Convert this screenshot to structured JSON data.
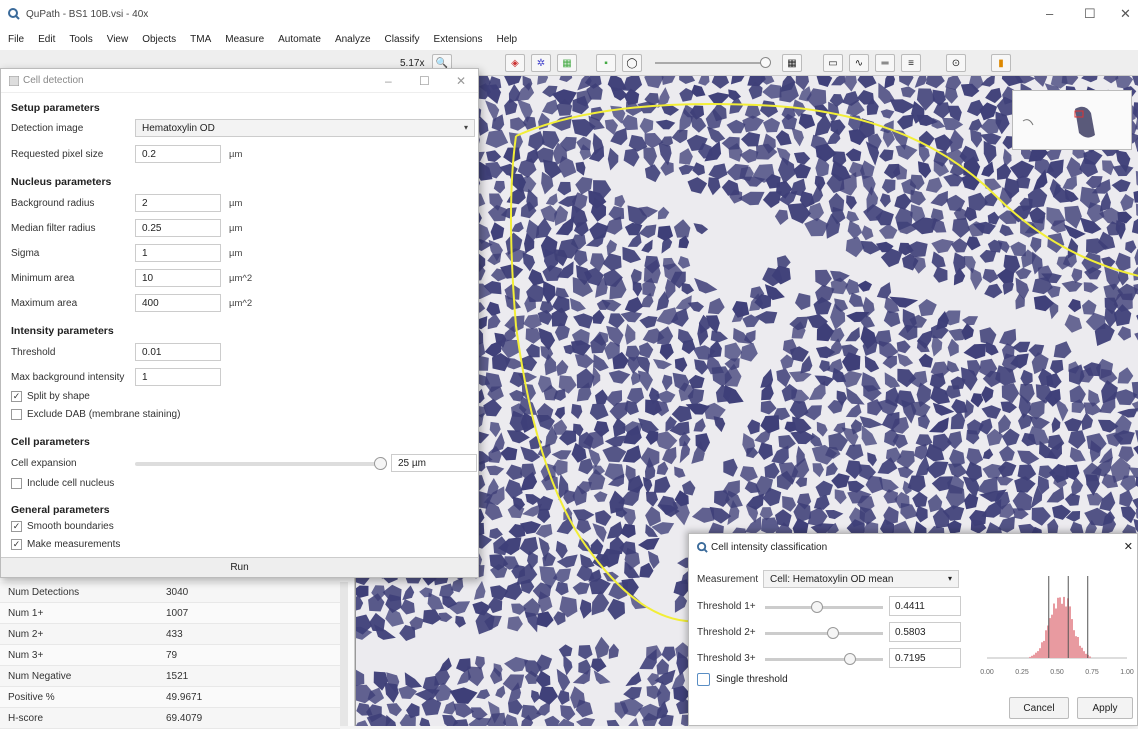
{
  "window": {
    "title": "QuPath - BS1 10B.vsi - 40x",
    "minimize": "–",
    "maximize": "☐",
    "close": "✕"
  },
  "menu": [
    "File",
    "Edit",
    "Tools",
    "View",
    "Objects",
    "TMA",
    "Measure",
    "Automate",
    "Analyze",
    "Classify",
    "Extensions",
    "Help"
  ],
  "toolbar": {
    "zoom": "5.17x"
  },
  "cell_detection": {
    "title": "Cell detection",
    "sections": {
      "setup": "Setup parameters",
      "nucleus": "Nucleus parameters",
      "intensity": "Intensity parameters",
      "cell": "Cell parameters",
      "general": "General parameters"
    },
    "detection_image": {
      "label": "Detection image",
      "value": "Hematoxylin OD"
    },
    "pixel_size": {
      "label": "Requested pixel size",
      "value": "0.2",
      "unit": "µm"
    },
    "background_radius": {
      "label": "Background radius",
      "value": "2",
      "unit": "µm"
    },
    "median_filter": {
      "label": "Median filter radius",
      "value": "0.25",
      "unit": "µm"
    },
    "sigma": {
      "label": "Sigma",
      "value": "1",
      "unit": "µm"
    },
    "min_area": {
      "label": "Minimum area",
      "value": "10",
      "unit": "µm^2"
    },
    "max_area": {
      "label": "Maximum area",
      "value": "400",
      "unit": "µm^2"
    },
    "threshold": {
      "label": "Threshold",
      "value": "0.01"
    },
    "max_bg_intensity": {
      "label": "Max background intensity",
      "value": "1"
    },
    "split_by_shape": {
      "label": "Split by shape",
      "checked": true
    },
    "exclude_dab": {
      "label": "Exclude DAB (membrane staining)",
      "checked": false
    },
    "cell_expansion": {
      "label": "Cell expansion",
      "value": "25 µm",
      "slider_fraction": 1.0
    },
    "include_nucleus": {
      "label": "Include cell nucleus",
      "checked": false
    },
    "smooth_boundaries": {
      "label": "Smooth boundaries",
      "checked": true
    },
    "make_measurements": {
      "label": "Make measurements",
      "checked": true
    },
    "run": "Run"
  },
  "measurements": [
    {
      "key": "Num Detections",
      "value": "3040"
    },
    {
      "key": "Num 1+",
      "value": "1007"
    },
    {
      "key": "Num 2+",
      "value": "433"
    },
    {
      "key": "Num 3+",
      "value": "79"
    },
    {
      "key": "Num Negative",
      "value": "1521"
    },
    {
      "key": "Positive %",
      "value": "49.9671"
    },
    {
      "key": "H-score",
      "value": "69.4079"
    }
  ],
  "intensity_dialog": {
    "title": "Cell intensity classification",
    "measurement_label": "Measurement",
    "measurement_value": "Cell: Hematoxylin OD mean",
    "thresholds": [
      {
        "label": "Threshold 1+",
        "value": "0.4411",
        "fraction": 0.4411
      },
      {
        "label": "Threshold 2+",
        "value": "0.5803",
        "fraction": 0.5803
      },
      {
        "label": "Threshold 3+",
        "value": "0.7195",
        "fraction": 0.7195
      }
    ],
    "single_threshold": "Single threshold",
    "cancel": "Cancel",
    "apply": "Apply",
    "close": "✕",
    "histogram_ticks": [
      "0.00",
      "0.25",
      "0.50",
      "0.75",
      "1.00"
    ]
  },
  "colors": {
    "tissue": "#3e3f78",
    "annotation": "#f2ee37",
    "histogram": "#e89aa0"
  }
}
